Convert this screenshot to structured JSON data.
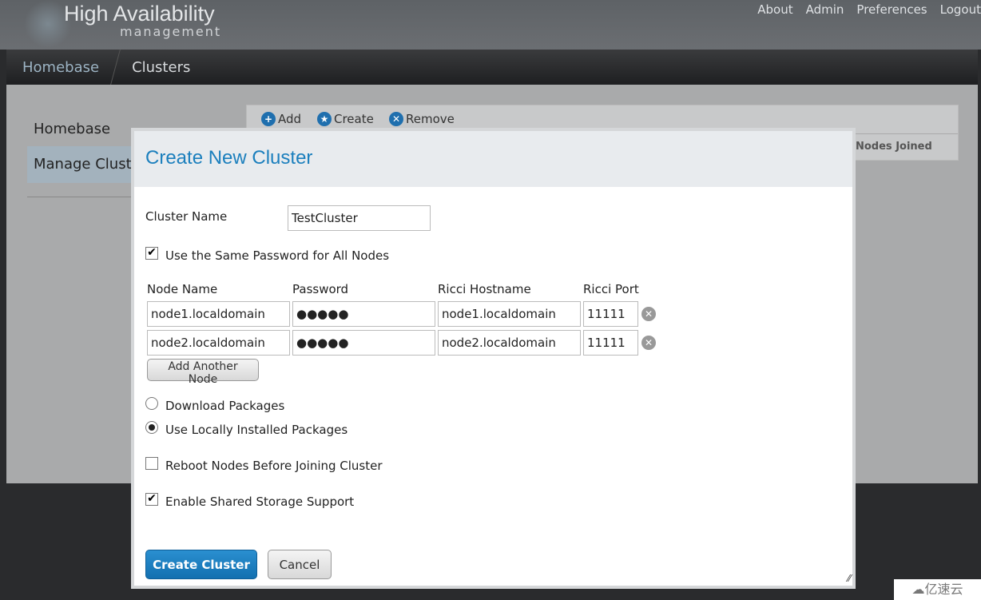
{
  "header": {
    "brand": "High Availability",
    "brand_sub": "management",
    "links": [
      "About",
      "Admin",
      "Preferences",
      "Logout"
    ]
  },
  "breadcrumb": [
    "Homebase",
    "Clusters"
  ],
  "sidebar": [
    "Homebase",
    "Manage Clusters"
  ],
  "toolbar": {
    "add": "Add",
    "create": "Create",
    "remove": "Remove",
    "column": "Nodes Joined"
  },
  "dialog": {
    "title": "Create New Cluster",
    "cluster_name_label": "Cluster Name",
    "cluster_name": "TestCluster",
    "same_password_label": "Use the Same Password for All Nodes",
    "same_password": true,
    "columns": [
      "Node Name",
      "Password",
      "Ricci Hostname",
      "Ricci Port"
    ],
    "nodes": [
      {
        "name": "node1.localdomain",
        "password": "●●●●●",
        "hostname": "node1.localdomain",
        "port": "11111"
      },
      {
        "name": "node2.localdomain",
        "password": "●●●●●",
        "hostname": "node2.localdomain",
        "port": "11111"
      }
    ],
    "add_node": "Add Another Node",
    "download_label": "Download Packages",
    "local_label": "Use Locally Installed Packages",
    "package_choice": "local",
    "reboot_label": "Reboot Nodes Before Joining Cluster",
    "reboot": false,
    "shared_label": "Enable Shared Storage Support",
    "shared": true,
    "create_btn": "Create Cluster",
    "cancel_btn": "Cancel"
  },
  "watermark": "☁亿速云"
}
